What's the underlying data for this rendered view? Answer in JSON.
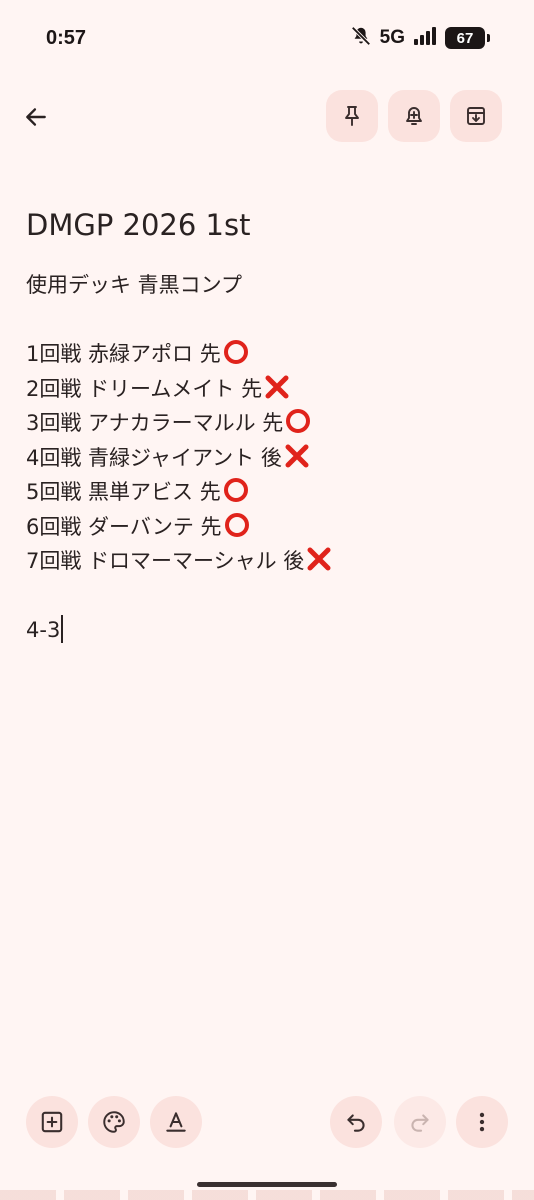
{
  "status": {
    "time": "0:57",
    "network": "5G",
    "battery": "67"
  },
  "toolbar": {
    "back_icon": "arrow-left-icon",
    "pin_icon": "pin-icon",
    "reminder_icon": "bell-plus-icon",
    "archive_icon": "archive-icon"
  },
  "note": {
    "title": "DMGP 2026 1st",
    "deck_line": "使用デッキ 青黒コンプ",
    "rounds": [
      {
        "text": "1回戦 赤緑アポロ 先",
        "result": "win"
      },
      {
        "text": "2回戦 ドリームメイト 先",
        "result": "loss"
      },
      {
        "text": "3回戦 アナカラーマルル 先",
        "result": "win"
      },
      {
        "text": "4回戦 青緑ジャイアント 後",
        "result": "loss"
      },
      {
        "text": "5回戦 黒単アビス 先",
        "result": "win"
      },
      {
        "text": "6回戦 ダーバンテ 先",
        "result": "win"
      },
      {
        "text": "7回戦 ドロマーマーシャル 後",
        "result": "loss"
      }
    ],
    "record": "4-3"
  },
  "bottom_bar": {
    "add_icon": "add-box-icon",
    "palette_icon": "palette-icon",
    "text_format_icon": "text-format-icon",
    "undo_icon": "undo-icon",
    "redo_icon": "redo-icon",
    "more_icon": "more-vert-icon"
  },
  "colors": {
    "background": "#fff5f3",
    "button_bg": "#fbe2de",
    "win_mark": "#e0231b",
    "loss_mark": "#e0231b"
  }
}
